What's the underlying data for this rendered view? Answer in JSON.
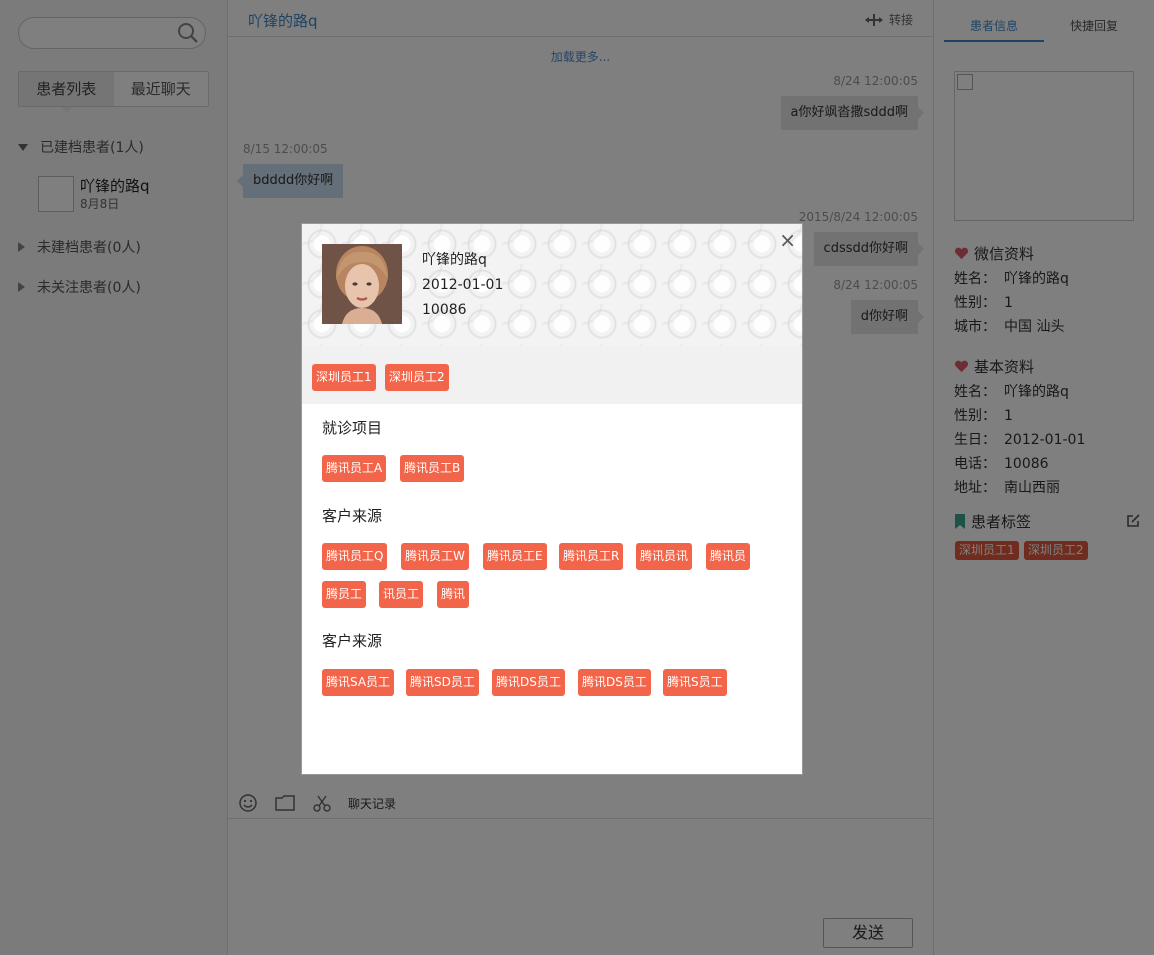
{
  "left": {
    "search": {
      "placeholder": ""
    },
    "tabs": [
      "患者列表",
      "最近聊天"
    ],
    "groups": [
      {
        "label": "已建档患者(1人)",
        "expanded": true
      },
      {
        "label": "未建档患者(0人)",
        "expanded": false
      },
      {
        "label": "未关注患者(0人)",
        "expanded": false
      }
    ],
    "patient": {
      "name": "吖锋的路q",
      "date": "8月8日"
    }
  },
  "chat": {
    "title": "吖锋的路q",
    "transfer_label": "转接",
    "load_more": "加载更多...",
    "messages": [
      {
        "time": "8/24 12:00:05",
        "text": "a你好飒沓撒sddd啊",
        "side": "right"
      },
      {
        "time": "8/15 12:00:05",
        "text": "bdddd你好啊",
        "side": "left"
      },
      {
        "time": "2015/8/24 12:00:05",
        "text": "cdssdd你好啊",
        "side": "right"
      },
      {
        "time": "8/24 12:00:05",
        "text": "d你好啊",
        "side": "right"
      }
    ],
    "history_label": "聊天记录",
    "send_label": "发送"
  },
  "right": {
    "tabs": [
      "患者信息",
      "快捷回复"
    ],
    "wechat": {
      "title": "微信资料",
      "rows": [
        {
          "k": "姓名：",
          "v": "吖锋的路q"
        },
        {
          "k": "性别：",
          "v": "1"
        },
        {
          "k": "城市：",
          "v": "中国 汕头"
        }
      ]
    },
    "basic": {
      "title": "基本资料",
      "rows": [
        {
          "k": "姓名：",
          "v": "吖锋的路q"
        },
        {
          "k": "性别：",
          "v": "1"
        },
        {
          "k": "生日：",
          "v": "2012-01-01"
        },
        {
          "k": "电话：",
          "v": "10086"
        },
        {
          "k": "地址：",
          "v": "南山西丽"
        }
      ]
    },
    "tags_title": "患者标签",
    "tags": [
      "深圳员工1",
      "深圳员工2"
    ]
  },
  "modal": {
    "name": "吖锋的路q",
    "birthday": "2012-01-01",
    "phone": "10086",
    "close": "×",
    "top_tags": [
      "深圳员工1",
      "深圳员工2"
    ],
    "sections": [
      {
        "title": "就诊项目",
        "tags": [
          "腾讯员工A",
          "腾讯员工B"
        ]
      },
      {
        "title": "客户来源",
        "tags": [
          "腾讯员工Q",
          "腾讯员工W",
          "腾讯员工E",
          "腾讯员工R",
          "腾讯员讯",
          "腾讯员",
          "腾员工",
          "讯员工",
          "腾讯"
        ]
      },
      {
        "title": "客户来源",
        "tags": [
          "腾讯SA员工",
          "腾讯SD员工",
          "腾讯DS员工",
          "腾讯DS员工",
          "腾讯S员工"
        ]
      }
    ]
  },
  "colors": {
    "accent": "#3f86c4",
    "tag": "#f2654a",
    "heart": "#d95b6a",
    "bookmark": "#3aa58f"
  }
}
